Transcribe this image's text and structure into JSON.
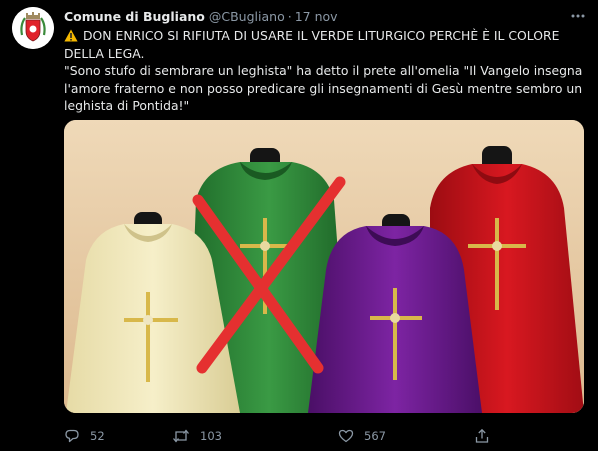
{
  "account": {
    "display_name": "Comune di Bugliano",
    "handle": "@CBugliano",
    "separator": "·",
    "date": "17 nov"
  },
  "tweet": {
    "headline": "DON ENRICO SI RIFIUTA DI USARE IL VERDE LITURGICO PERCHÈ È IL COLORE DELLA LEGA.",
    "quote": "\"Sono stufo di sembrare un leghista\" ha detto il prete all'omelia \"Il Vangelo insegna l'amore fraterno e non posso predicare gli insegnamenti di Gesù mentre sembro un leghista di Pontida!\""
  },
  "media": {
    "vestments": [
      "cream",
      "green",
      "purple",
      "red"
    ],
    "crossed_out": "green",
    "colors": {
      "background": "#e8cdaa",
      "cream": "#f1e9bf",
      "green": "#2f8a3a",
      "purple": "#6a1a8c",
      "red": "#c8141c",
      "cross_mark": "#e53030",
      "gold": "#d8b84a"
    }
  },
  "actions": {
    "replies": "52",
    "retweets": "103",
    "likes": "567"
  },
  "icons": {
    "avatar": "coat-of-arms-icon",
    "more": "more-horizontal-icon",
    "warning": "warning-icon",
    "reply": "reply-icon",
    "retweet": "retweet-icon",
    "like": "heart-icon",
    "share": "share-icon"
  },
  "theme": {
    "background": "#000000",
    "text": "#e7e9ea",
    "muted": "#8b98a5"
  }
}
